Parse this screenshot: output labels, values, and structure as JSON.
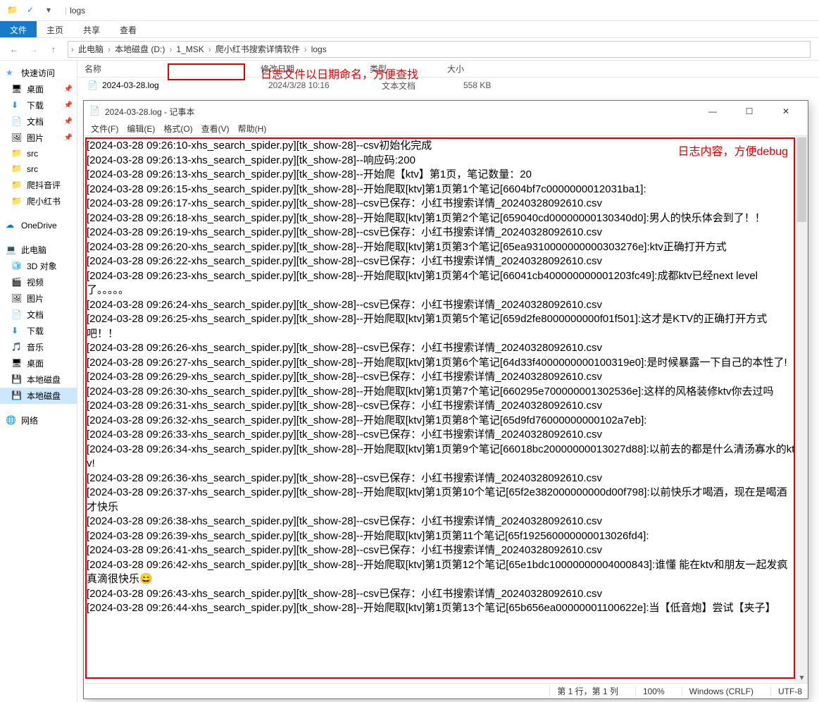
{
  "titlebar": {
    "sep": "|",
    "title": "logs"
  },
  "ribbon": {
    "tabs": [
      "文件",
      "主页",
      "共享",
      "查看"
    ]
  },
  "breadcrumb": [
    "此电脑",
    "本地磁盘 (D:)",
    "1_MSK",
    "爬小红书搜索详情软件",
    "logs"
  ],
  "columns": {
    "name": "名称",
    "date": "修改日期",
    "type": "类型",
    "size": "大小"
  },
  "file": {
    "name": "2024-03-28.log",
    "date": "2024/3/28 10:16",
    "type": "文本文档",
    "size": "558 KB"
  },
  "annotation1": "日志文件以日期命名，方便查找",
  "annotation2": "日志内容，方便debug",
  "sidebar": {
    "quick": "快速访问",
    "items1": [
      "桌面",
      "下载",
      "文档",
      "图片",
      "src",
      "src",
      "爬抖音评",
      "爬小红书"
    ],
    "onedrive": "OneDrive",
    "thispc": "此电脑",
    "items2": [
      "3D 对象",
      "视频",
      "图片",
      "文档",
      "下载",
      "音乐",
      "桌面",
      "本地磁盘",
      "本地磁盘"
    ],
    "network": "网络"
  },
  "notepad": {
    "title": "2024-03-28.log - 记事本",
    "menu": {
      "file": "文件(F)",
      "edit": "编辑(E)",
      "format": "格式(O)",
      "view": "查看(V)",
      "help": "帮助(H)"
    },
    "status": {
      "pos": "第 1 行，第 1 列",
      "zoom": "100%",
      "eol": "Windows (CRLF)",
      "enc": "UTF-8"
    },
    "lines": [
      "[2024-03-28 09:26:10-xhs_search_spider.py][tk_show-28]--csv初始化完成",
      "[2024-03-28 09:26:13-xhs_search_spider.py][tk_show-28]--响应码:200",
      "[2024-03-28 09:26:13-xhs_search_spider.py][tk_show-28]--开始爬【ktv】第1页，笔记数量：20",
      "[2024-03-28 09:26:15-xhs_search_spider.py][tk_show-28]--开始爬取[ktv]第1页第1个笔记[6604bf7c0000000012031ba1]:",
      "[2024-03-28 09:26:17-xhs_search_spider.py][tk_show-28]--csv已保存：小红书搜索详情_20240328092610.csv",
      "[2024-03-28 09:26:18-xhs_search_spider.py][tk_show-28]--开始爬取[ktv]第1页第2个笔记[659040cd00000000130340d0]:男人的快乐体会到了！！",
      "[2024-03-28 09:26:19-xhs_search_spider.py][tk_show-28]--csv已保存：小红书搜索详情_20240328092610.csv",
      "[2024-03-28 09:26:20-xhs_search_spider.py][tk_show-28]--开始爬取[ktv]第1页第3个笔记[65ea9310000000000303276e]:ktv正确打开方式",
      "[2024-03-28 09:26:22-xhs_search_spider.py][tk_show-28]--csv已保存：小红书搜索详情_20240328092610.csv",
      "[2024-03-28 09:26:23-xhs_search_spider.py][tk_show-28]--开始爬取[ktv]第1页第4个笔记[66041cb400000000001203fc49]:成都ktv已经next level 了。。。。。",
      "[2024-03-28 09:26:24-xhs_search_spider.py][tk_show-28]--csv已保存：小红书搜索详情_20240328092610.csv",
      "[2024-03-28 09:26:25-xhs_search_spider.py][tk_show-28]--开始爬取[ktv]第1页第5个笔记[659d2fe8000000000f01f501]:这才是KTV的正确打开方式吧！！",
      "[2024-03-28 09:26:26-xhs_search_spider.py][tk_show-28]--csv已保存：小红书搜索详情_20240328092610.csv",
      "[2024-03-28 09:26:27-xhs_search_spider.py][tk_show-28]--开始爬取[ktv]第1页第6个笔记[64d33f4000000000100319e0]:是时候暴露一下自己的本性了!",
      "[2024-03-28 09:26:29-xhs_search_spider.py][tk_show-28]--csv已保存：小红书搜索详情_20240328092610.csv",
      "[2024-03-28 09:26:30-xhs_search_spider.py][tk_show-28]--开始爬取[ktv]第1页第7个笔记[660295e700000001302536e]:这样的风格装修ktv你去过吗",
      "[2024-03-28 09:26:31-xhs_search_spider.py][tk_show-28]--csv已保存：小红书搜索详情_20240328092610.csv",
      "[2024-03-28 09:26:32-xhs_search_spider.py][tk_show-28]--开始爬取[ktv]第1页第8个笔记[65d9fd76000000000102a7eb]:",
      "[2024-03-28 09:26:33-xhs_search_spider.py][tk_show-28]--csv已保存：小红书搜索详情_20240328092610.csv",
      "[2024-03-28 09:26:34-xhs_search_spider.py][tk_show-28]--开始爬取[ktv]第1页第9个笔记[66018bc20000000013027d88]:以前去的都是什么清汤寡水的ktv!",
      "[2024-03-28 09:26:36-xhs_search_spider.py][tk_show-28]--csv已保存：小红书搜索详情_20240328092610.csv",
      "[2024-03-28 09:26:37-xhs_search_spider.py][tk_show-28]--开始爬取[ktv]第1页第10个笔记[65f2e382000000000d00f798]:以前快乐才喝酒，现在是喝酒才快乐",
      "[2024-03-28 09:26:38-xhs_search_spider.py][tk_show-28]--csv已保存：小红书搜索详情_20240328092610.csv",
      "[2024-03-28 09:26:39-xhs_search_spider.py][tk_show-28]--开始爬取[ktv]第1页第11个笔记[65f192560000000013026fd4]:",
      "[2024-03-28 09:26:41-xhs_search_spider.py][tk_show-28]--csv已保存：小红书搜索详情_20240328092610.csv",
      "[2024-03-28 09:26:42-xhs_search_spider.py][tk_show-28]--开始爬取[ktv]第1页第12个笔记[65e1bdc10000000004000843]:谁懂 能在ktv和朋友一起发疯真滴很快乐😄",
      "[2024-03-28 09:26:43-xhs_search_spider.py][tk_show-28]--csv已保存：小红书搜索详情_20240328092610.csv",
      "[2024-03-28 09:26:44-xhs_search_spider.py][tk_show-28]--开始爬取[ktv]第1页第13个笔记[65b656ea00000001100622e]:当【低音炮】尝试【夹子】"
    ]
  }
}
